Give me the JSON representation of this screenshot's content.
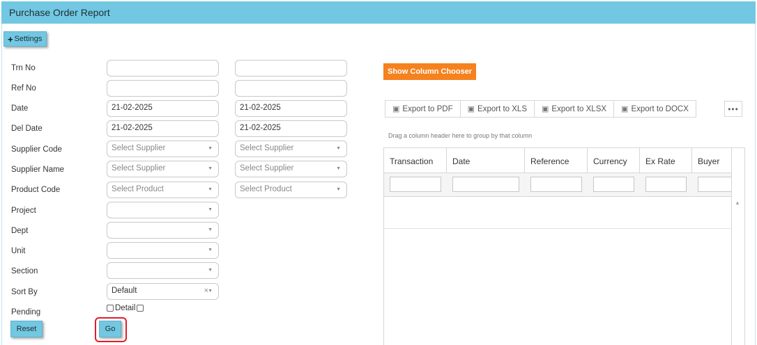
{
  "header": {
    "title": "Purchase Order Report"
  },
  "settings": {
    "label": "Settings"
  },
  "form": {
    "fields": [
      {
        "label": "Trn No",
        "from": "",
        "to": ""
      },
      {
        "label": "Ref No",
        "from": "",
        "to": ""
      },
      {
        "label": "Date",
        "from": "21-02-2025",
        "to": "21-02-2025"
      },
      {
        "label": "Del Date",
        "from": "21-02-2025",
        "to": "21-02-2025"
      },
      {
        "label": "Supplier Code",
        "from_placeholder": "Select Supplier",
        "to_placeholder": "Select Supplier"
      },
      {
        "label": "Supplier Name",
        "from_placeholder": "Select Supplier",
        "to_placeholder": "Select Supplier"
      },
      {
        "label": "Product Code",
        "from_placeholder": "Select Product",
        "to_placeholder": "Select Product"
      },
      {
        "label": "Project",
        "value": ""
      },
      {
        "label": "Dept",
        "value": ""
      },
      {
        "label": "Unit",
        "value": ""
      },
      {
        "label": "Section",
        "value": ""
      },
      {
        "label": "Sort By",
        "value": "Default"
      },
      {
        "label": "Pending",
        "checkbox_label": "Detail"
      }
    ],
    "reset_label": "Reset",
    "go_label": "Go"
  },
  "grid": {
    "column_chooser_label": "Show Column Chooser",
    "export_buttons": [
      "Export to PDF",
      "Export to XLS",
      "Export to XLSX",
      "Export to DOCX"
    ],
    "more_label": "•••",
    "group_hint": "Drag a column header here to group by that column",
    "columns": [
      "Transaction",
      "Date",
      "Reference",
      "Currency",
      "Ex Rate",
      "Buyer"
    ]
  },
  "colors": {
    "header_bg": "#72c8e2",
    "accent_orange": "#f5821f",
    "highlight_red": "#e01d2a"
  }
}
